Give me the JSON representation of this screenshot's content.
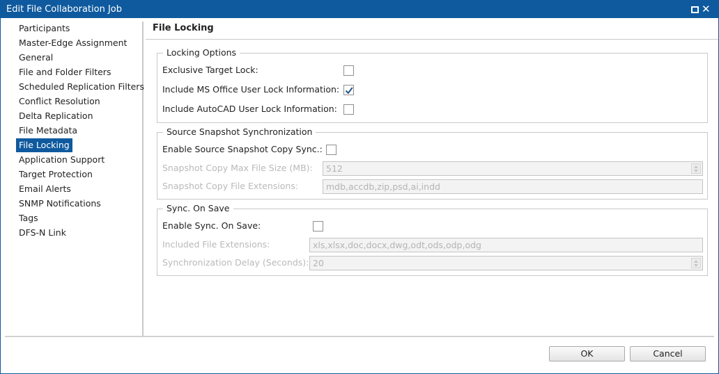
{
  "window": {
    "title": "Edit File Collaboration Job"
  },
  "sidebar": {
    "items": [
      {
        "label": "Participants"
      },
      {
        "label": "Master-Edge Assignment"
      },
      {
        "label": "General"
      },
      {
        "label": "File and Folder Filters"
      },
      {
        "label": "Scheduled Replication Filters"
      },
      {
        "label": "Conflict Resolution"
      },
      {
        "label": "Delta Replication"
      },
      {
        "label": "File Metadata"
      },
      {
        "label": "File Locking",
        "selected": true
      },
      {
        "label": "Application Support"
      },
      {
        "label": "Target Protection"
      },
      {
        "label": "Email Alerts"
      },
      {
        "label": "SNMP Notifications"
      },
      {
        "label": "Tags"
      },
      {
        "label": "DFS-N Link"
      }
    ]
  },
  "main": {
    "title": "File Locking",
    "locking_options": {
      "legend": "Locking Options",
      "exclusive_target_lock": {
        "label": "Exclusive Target Lock:",
        "checked": false
      },
      "ms_office_lock": {
        "label": "Include MS Office User Lock Information:",
        "checked": true
      },
      "autocad_lock": {
        "label": "Include AutoCAD User Lock Information:",
        "checked": false
      }
    },
    "snapshot_sync": {
      "legend": "Source Snapshot Synchronization",
      "enable": {
        "label": "Enable Source Snapshot Copy Sync.:",
        "checked": false
      },
      "max_file_size": {
        "label": "Snapshot Copy Max File Size (MB):",
        "value": "512"
      },
      "file_extensions": {
        "label": "Snapshot Copy File Extensions:",
        "value": "mdb,accdb,zip,psd,ai,indd"
      }
    },
    "sync_on_save": {
      "legend": "Sync. On Save",
      "enable": {
        "label": "Enable Sync. On Save:",
        "checked": false
      },
      "included_extensions": {
        "label": "Included File Extensions:",
        "value": "xls,xlsx,doc,docx,dwg,odt,ods,odp,odg"
      },
      "sync_delay": {
        "label": "Synchronization Delay (Seconds):",
        "value": "20"
      }
    }
  },
  "footer": {
    "ok_label": "OK",
    "cancel_label": "Cancel"
  },
  "colors": {
    "accent": "#0f5a9e",
    "border": "#c8c8c8",
    "disabled_text": "#b9b9b9"
  }
}
